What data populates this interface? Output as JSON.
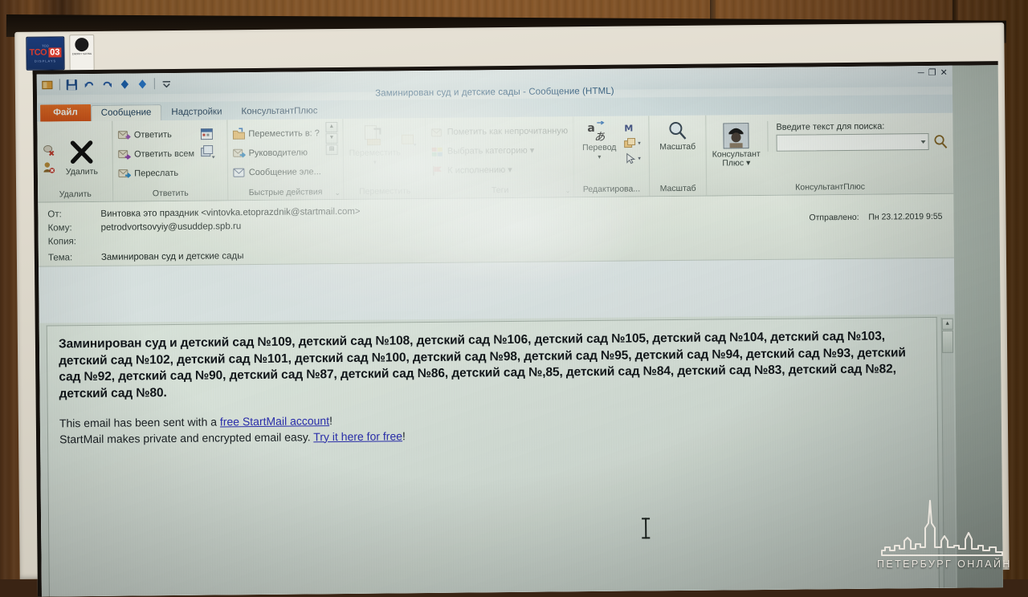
{
  "window": {
    "title": "Заминирован суд и детские сады  -  Сообщение (HTML)",
    "minimize": "─",
    "restore": "❐",
    "close": "✕",
    "help_icon": "?"
  },
  "quick_access": {
    "items": [
      {
        "name": "outlook-icon",
        "glyph": "▤"
      },
      {
        "name": "save-icon",
        "glyph": "💾"
      },
      {
        "name": "undo-icon",
        "glyph": "↰"
      },
      {
        "name": "redo-icon",
        "glyph": "↻"
      },
      {
        "name": "previous-item-icon",
        "glyph": "◆"
      },
      {
        "name": "next-item-icon",
        "glyph": "◆"
      },
      {
        "name": "customize-qat-icon",
        "glyph": "⌄"
      }
    ]
  },
  "tabs": [
    {
      "label": "Файл",
      "kind": "file"
    },
    {
      "label": "Сообщение",
      "kind": "active"
    },
    {
      "label": "Надстройки",
      "kind": "normal"
    },
    {
      "label": "КонсультантПлюс",
      "kind": "normal"
    }
  ],
  "ribbon": {
    "groups": [
      {
        "label": "Удалить",
        "big_buttons": [
          {
            "label": "Удалить",
            "icon": "delete-x-icon"
          }
        ],
        "small_items": []
      },
      {
        "label": "Ответить",
        "small_items": [
          {
            "label": "Ответить",
            "icon": "reply-icon"
          },
          {
            "label": "Ответить всем",
            "icon": "reply-all-icon"
          },
          {
            "label": "Переслать",
            "icon": "forward-icon"
          }
        ]
      },
      {
        "label": "Быстрые действия",
        "small_items": [
          {
            "label": "Переместить в: ?",
            "icon": "move-to-folder-icon"
          },
          {
            "label": "Руководителю",
            "icon": "to-manager-icon"
          },
          {
            "label": "Сообщение эле...",
            "icon": "email-message-icon"
          }
        ]
      },
      {
        "label": "Переместить",
        "big_buttons": [
          {
            "label": "Переместить",
            "icon": "move-icon"
          }
        ],
        "small_items": []
      },
      {
        "label": "Теги",
        "small_items": [
          {
            "label": "Пометить как непрочитанную",
            "icon": "mark-unread-icon"
          },
          {
            "label": "Выбрать категорию ▾",
            "icon": "categorize-icon"
          },
          {
            "label": "К исполнению ▾",
            "icon": "follow-up-icon"
          }
        ]
      },
      {
        "label": "Редактирова...",
        "big_buttons": [
          {
            "label": "Перевод",
            "icon": "translate-icon"
          }
        ],
        "small_items": [
          {
            "label": "",
            "icon": "find-icon"
          },
          {
            "label": "",
            "icon": "related-icon"
          },
          {
            "label": "",
            "icon": "select-icon"
          }
        ]
      },
      {
        "label": "Масштаб",
        "big_buttons": [
          {
            "label": "Масштаб",
            "icon": "zoom-magnifier-icon"
          }
        ],
        "small_items": []
      },
      {
        "label": "КонсультантПлюс",
        "big_buttons": [
          {
            "label": "Консультант Плюс ▾",
            "icon": "consultant-plus-icon"
          }
        ],
        "small_items": []
      }
    ],
    "search": {
      "label": "Введите текст для поиска:",
      "value": "",
      "placeholder": "",
      "button_icon": "search-magnifier-icon"
    }
  },
  "message": {
    "fields": [
      {
        "label": "От:",
        "value": "Винтовка это праздник <vintovka.etoprazdnik@startmail.com>"
      },
      {
        "label": "Кому:",
        "value": "petrodvortsovyiy@usuddep.spb.ru"
      },
      {
        "label": "Копия:",
        "value": ""
      },
      {
        "label": "Тема:",
        "value": "Заминирован суд и детские сады"
      }
    ],
    "sent_label": "Отправлено:",
    "sent_value": "Пн 23.12.2019 9:55",
    "body_paragraph": "Заминирован суд и детский сад №109, детский сад №108, детский сад №106, детский сад №105, детский сад №104, детский сад №103, детский сад №102, детский сад №101, детский сад №100, детский сад №98, детский сад №95, детский сад №94, детский сад №93, детский сад №92, детский сад №90, детский сад №87, детский сад №86, детский сад №,85, детский сад №84, детский сад №83, детский сад №82, детский сад №80.",
    "signature": {
      "line1_pre": "This email has been sent with a ",
      "line1_link": "free StartMail account",
      "line1_post": "!",
      "line2_pre": "StartMail makes private and encrypted email easy. ",
      "line2_link": "Try it here for free",
      "line2_post": "!"
    }
  },
  "scrollbar": {
    "up_arrow": "▲",
    "down_arrow": "▼"
  },
  "monitor": {
    "sticker_tco_top": "TCO",
    "sticker_tco_a": "TCO",
    "sticker_tco_b": "03",
    "sticker_tco_sub": "DISPLAYS",
    "sticker_eco_text": "ENERGY SAVING"
  },
  "watermark": {
    "text": "ПЕТЕРБУРГ ОНЛАЙН"
  },
  "colors": {
    "file_tab": "#ef7126",
    "title_text": "#23527a",
    "link": "#2b2fb8",
    "screen_bg": "#e8eee8"
  }
}
